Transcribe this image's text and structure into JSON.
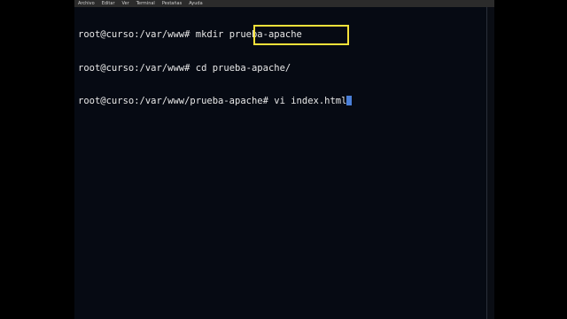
{
  "menubar": {
    "items": [
      "Archivo",
      "Editar",
      "Ver",
      "Terminal",
      "Pestañas",
      "Ayuda"
    ]
  },
  "terminal": {
    "lines": [
      {
        "prompt": "root@curso:/var/www# ",
        "command": "mkdir prueba-apache"
      },
      {
        "prompt": "root@curso:/var/www# ",
        "command": "cd prueba-apache/"
      },
      {
        "prompt": "root@curso:/var/www/prueba-apache# ",
        "command": "vi index.html"
      }
    ]
  },
  "colors": {
    "terminal_background": "#060a13",
    "text": "#e8e8e8",
    "cursor": "#4a7fd8",
    "highlight": "#f5e13a"
  }
}
